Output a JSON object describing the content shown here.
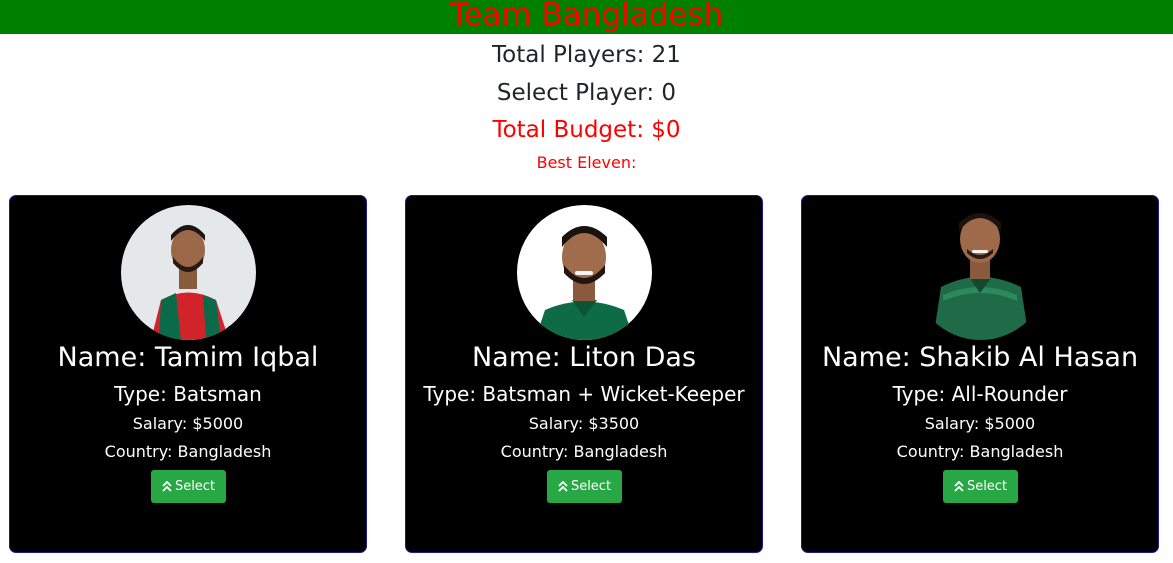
{
  "header": {
    "title": "Team Bangladesh",
    "bar_color": "#008000",
    "title_color": "#ff0000"
  },
  "summary": {
    "total_players": "Total Players: 21",
    "select_player": "Select Player: 0",
    "total_budget": "Total Budget: $0",
    "best_eleven": "Best Eleven:"
  },
  "players": [
    {
      "name": "Name: Tamim Iqbal",
      "type": "Type: Batsman",
      "salary": "Salary: $5000",
      "country": "Country: Bangladesh",
      "button_label": "Select",
      "button_icon": "double-chevron-up-icon"
    },
    {
      "name": "Name: Liton Das",
      "type": "Type: Batsman + Wicket-Keeper",
      "salary": "Salary: $3500",
      "country": "Country: Bangladesh",
      "button_label": "Select",
      "button_icon": "double-chevron-up-icon"
    },
    {
      "name": "Name: Shakib Al Hasan",
      "type": "Type: All-Rounder",
      "salary": "Salary: $5000",
      "country": "Country: Bangladesh",
      "button_label": "Select",
      "button_icon": "double-chevron-up-icon"
    }
  ],
  "colors": {
    "button": "#28a745",
    "card_background": "#000000",
    "card_border": "#1a1aa0",
    "budget_text": "#ff0000"
  }
}
